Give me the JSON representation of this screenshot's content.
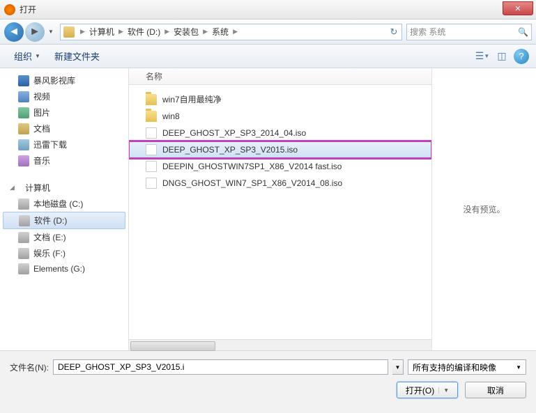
{
  "window": {
    "title": "打开"
  },
  "breadcrumb": {
    "items": [
      "计算机",
      "软件 (D:)",
      "安装包",
      "系统"
    ],
    "search_placeholder": "搜索 系统"
  },
  "toolbar": {
    "organize": "组织",
    "new_folder": "新建文件夹"
  },
  "sidebar": {
    "favorites": [
      {
        "label": "暴风影视库",
        "icon": "ico-video"
      },
      {
        "label": "视频",
        "icon": "ico-vid2"
      },
      {
        "label": "图片",
        "icon": "ico-pic"
      },
      {
        "label": "文档",
        "icon": "ico-doc"
      },
      {
        "label": "迅雷下载",
        "icon": "ico-dl"
      },
      {
        "label": "音乐",
        "icon": "ico-music"
      }
    ],
    "computer_label": "计算机",
    "drives": [
      {
        "label": "本地磁盘 (C:)",
        "selected": false
      },
      {
        "label": "软件 (D:)",
        "selected": true
      },
      {
        "label": "文档 (E:)",
        "selected": false
      },
      {
        "label": "娱乐 (F:)",
        "selected": false
      },
      {
        "label": "Elements (G:)",
        "selected": false
      }
    ]
  },
  "filelist": {
    "header": "名称",
    "files": [
      {
        "name": "win7自用最纯净",
        "type": "folder",
        "highlighted": false
      },
      {
        "name": "win8",
        "type": "folder",
        "highlighted": false
      },
      {
        "name": "DEEP_GHOST_XP_SP3_2014_04.iso",
        "type": "file",
        "highlighted": false
      },
      {
        "name": "DEEP_GHOST_XP_SP3_V2015.iso",
        "type": "file",
        "highlighted": true,
        "boxed": true
      },
      {
        "name": "DEEPIN_GHOSTWIN7SP1_X86_V2014 fast.iso",
        "type": "file",
        "highlighted": false
      },
      {
        "name": "DNGS_GHOST_WIN7_SP1_X86_V2014_08.iso",
        "type": "file",
        "highlighted": false
      }
    ]
  },
  "preview": {
    "text": "没有预览。"
  },
  "footer": {
    "filename_label": "文件名(N):",
    "filename_value": "DEEP_GHOST_XP_SP3_V2015.i",
    "filter": "所有支持的编译和映像",
    "open_btn": "打开(O)",
    "cancel_btn": "取消"
  }
}
